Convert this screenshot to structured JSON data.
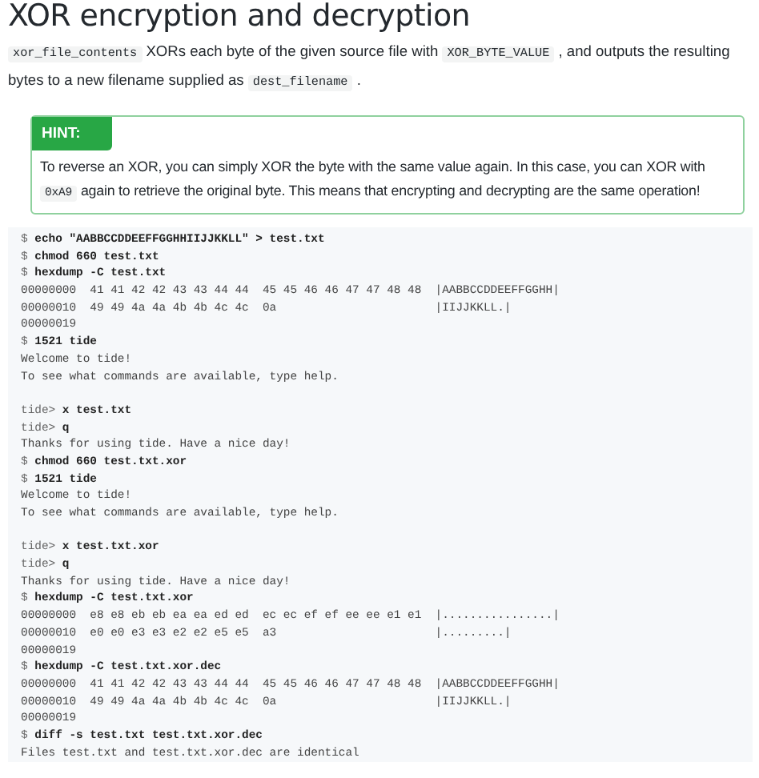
{
  "title": "XOR encryption and decryption",
  "intro": [
    {
      "kind": "code",
      "text": "xor_file_contents"
    },
    {
      "kind": "text",
      "text": " XORs each byte of the given source file with "
    },
    {
      "kind": "code",
      "text": "XOR_BYTE_VALUE"
    },
    {
      "kind": "text",
      "text": " , and outputs the resulting bytes to a new filename supplied as "
    },
    {
      "kind": "code",
      "text": "dest_filename"
    },
    {
      "kind": "text",
      "text": " ."
    }
  ],
  "hint": {
    "label": "HINT:",
    "body": [
      {
        "kind": "text",
        "text": "To reverse an XOR, you can simply XOR the byte with the same value again. In this case, you can XOR with "
      },
      {
        "kind": "code",
        "text": "0xA9"
      },
      {
        "kind": "text",
        "text": " again to retrieve the original byte. This means that encrypting and decrypting are the same operation!"
      }
    ]
  },
  "terminal": [
    {
      "kind": "command",
      "prompt": "$",
      "command": "echo \"AABBCCDDEEFFGGHHIIJJKKLL\" > test.txt"
    },
    {
      "kind": "command",
      "prompt": "$",
      "command": "chmod 660 test.txt"
    },
    {
      "kind": "command",
      "prompt": "$",
      "command": "hexdump -C test.txt"
    },
    {
      "kind": "output",
      "text": "00000000  41 41 42 42 43 43 44 44  45 45 46 46 47 47 48 48  |AABBCCDDEEFFGGHH|"
    },
    {
      "kind": "output",
      "text": "00000010  49 49 4a 4a 4b 4b 4c 4c  0a                       |IIJJKKLL.|"
    },
    {
      "kind": "output",
      "text": "00000019"
    },
    {
      "kind": "command",
      "prompt": "$",
      "command": "1521 tide"
    },
    {
      "kind": "output",
      "text": "Welcome to tide!"
    },
    {
      "kind": "output",
      "text": "To see what commands are available, type help."
    },
    {
      "kind": "blank"
    },
    {
      "kind": "command",
      "prompt": "tide>",
      "command": "x test.txt"
    },
    {
      "kind": "command",
      "prompt": "tide>",
      "command": "q"
    },
    {
      "kind": "output",
      "text": "Thanks for using tide. Have a nice day!"
    },
    {
      "kind": "command",
      "prompt": "$",
      "command": "chmod 660 test.txt.xor"
    },
    {
      "kind": "command",
      "prompt": "$",
      "command": "1521 tide"
    },
    {
      "kind": "output",
      "text": "Welcome to tide!"
    },
    {
      "kind": "output",
      "text": "To see what commands are available, type help."
    },
    {
      "kind": "blank"
    },
    {
      "kind": "command",
      "prompt": "tide>",
      "command": "x test.txt.xor"
    },
    {
      "kind": "command",
      "prompt": "tide>",
      "command": "q"
    },
    {
      "kind": "output",
      "text": "Thanks for using tide. Have a nice day!"
    },
    {
      "kind": "command",
      "prompt": "$",
      "command": "hexdump -C test.txt.xor"
    },
    {
      "kind": "output",
      "text": "00000000  e8 e8 eb eb ea ea ed ed  ec ec ef ef ee ee e1 e1  |................|"
    },
    {
      "kind": "output",
      "text": "00000010  e0 e0 e3 e3 e2 e2 e5 e5  a3                       |.........|"
    },
    {
      "kind": "output",
      "text": "00000019"
    },
    {
      "kind": "command",
      "prompt": "$",
      "command": "hexdump -C test.txt.xor.dec"
    },
    {
      "kind": "output",
      "text": "00000000  41 41 42 42 43 43 44 44  45 45 46 46 47 47 48 48  |AABBCCDDEEFFGGHH|"
    },
    {
      "kind": "output",
      "text": "00000010  49 49 4a 4a 4b 4b 4c 4c  0a                       |IIJJKKLL.|"
    },
    {
      "kind": "output",
      "text": "00000019"
    },
    {
      "kind": "command",
      "prompt": "$",
      "command": "diff -s test.txt test.txt.xor.dec"
    },
    {
      "kind": "output",
      "text": "Files test.txt and test.txt.xor.dec are identical"
    }
  ]
}
